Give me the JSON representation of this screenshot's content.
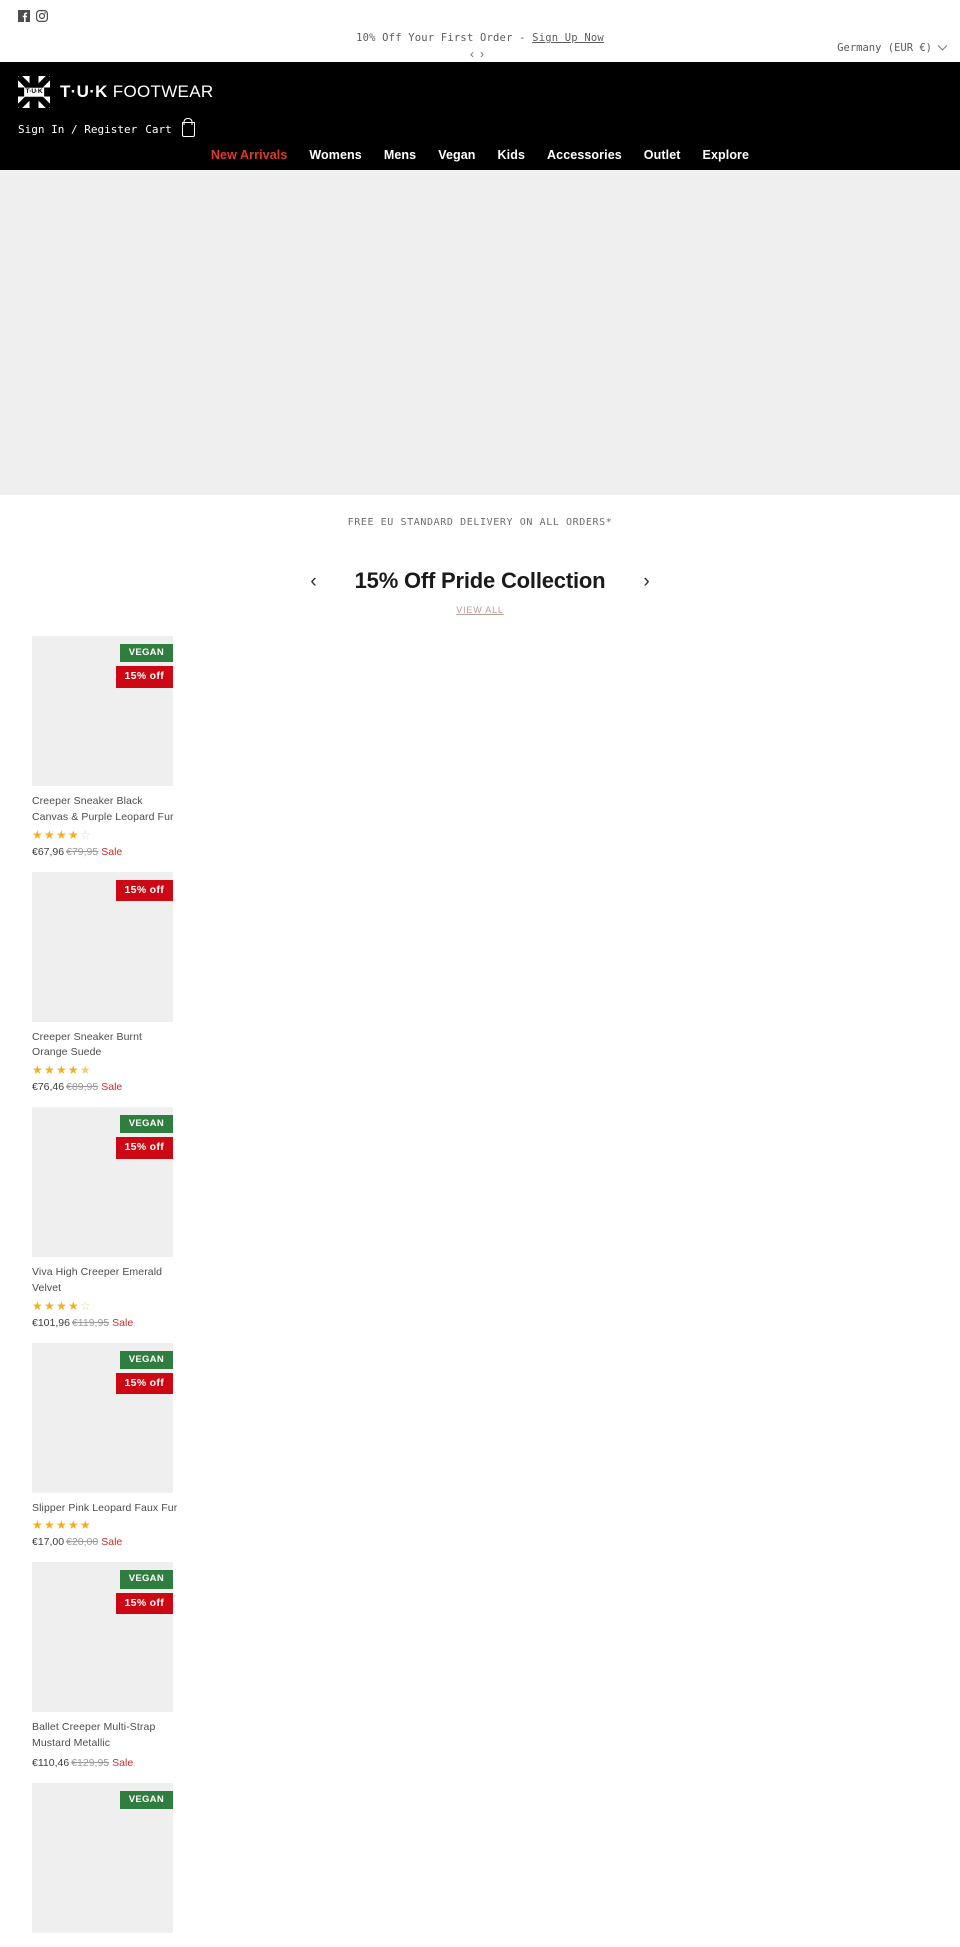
{
  "announcement": {
    "social": [
      {
        "name": "facebook-icon",
        "label": "Facebook"
      },
      {
        "name": "instagram-icon",
        "label": "Instagram"
      }
    ],
    "message_prefix": "10% Off Your First Order - ",
    "message_link": "Sign Up Now",
    "prev_arrow": "‹",
    "next_arrow": "›",
    "locale": "Germany (EUR €)"
  },
  "header": {
    "logo_mark_text": "T·U·K",
    "logo_bold": "T·U·K",
    "logo_light": " FOOTWEAR",
    "sign_in": "Sign In / Register",
    "cart": "Cart",
    "nav": [
      {
        "label": "New Arrivals",
        "active": true
      },
      {
        "label": "Womens",
        "active": false
      },
      {
        "label": "Mens",
        "active": false
      },
      {
        "label": "Vegan",
        "active": false
      },
      {
        "label": "Kids",
        "active": false
      },
      {
        "label": "Accessories",
        "active": false
      },
      {
        "label": "Outlet",
        "active": false
      },
      {
        "label": "Explore",
        "active": false
      }
    ]
  },
  "delivery_bar": "FREE EU STANDARD DELIVERY ON ALL ORDERS*",
  "collection": {
    "title": "15% Off Pride Collection",
    "prev_arrow": "‹",
    "next_arrow": "›",
    "view_all": "VIEW ALL"
  },
  "colors": {
    "vegan_badge": "#2f7d3f",
    "discount_badge": "#cc0814",
    "sale_text": "#cc2b28",
    "nav_active": "#e03a2f",
    "star": "#f2b01e"
  },
  "products": [
    {
      "title": "Creeper Sneaker Black Canvas & Purple Leopard Fur",
      "vegan_badge": "VEGAN",
      "discount_badge": "15% off",
      "rating": 4,
      "price": "€67,96",
      "compare_price": "€79,95",
      "sale_label": "Sale"
    },
    {
      "title": "Creeper Sneaker Burnt Orange Suede",
      "vegan_badge": "",
      "discount_badge": "15% off",
      "rating": 4.5,
      "price": "€76,46",
      "compare_price": "€89,95",
      "sale_label": "Sale"
    },
    {
      "title": "Viva High Creeper Emerald Velvet",
      "vegan_badge": "VEGAN",
      "discount_badge": "15% off",
      "rating": 4,
      "price": "€101,96",
      "compare_price": "€119,95",
      "sale_label": "Sale"
    },
    {
      "title": "Slipper Pink Leopard Faux Fur",
      "vegan_badge": "VEGAN",
      "discount_badge": "15% off",
      "rating": 5,
      "price": "€17,00",
      "compare_price": "€20,00",
      "sale_label": "Sale"
    },
    {
      "title": "Ballet Creeper Multi-Strap Mustard Metallic",
      "vegan_badge": "VEGAN",
      "discount_badge": "15% off",
      "rating": 0,
      "price": "€110,46",
      "compare_price": "€129,95",
      "sale_label": "Sale"
    },
    {
      "title": "",
      "vegan_badge": "VEGAN",
      "discount_badge": "",
      "rating": 0,
      "price": "",
      "compare_price": "",
      "sale_label": ""
    }
  ]
}
